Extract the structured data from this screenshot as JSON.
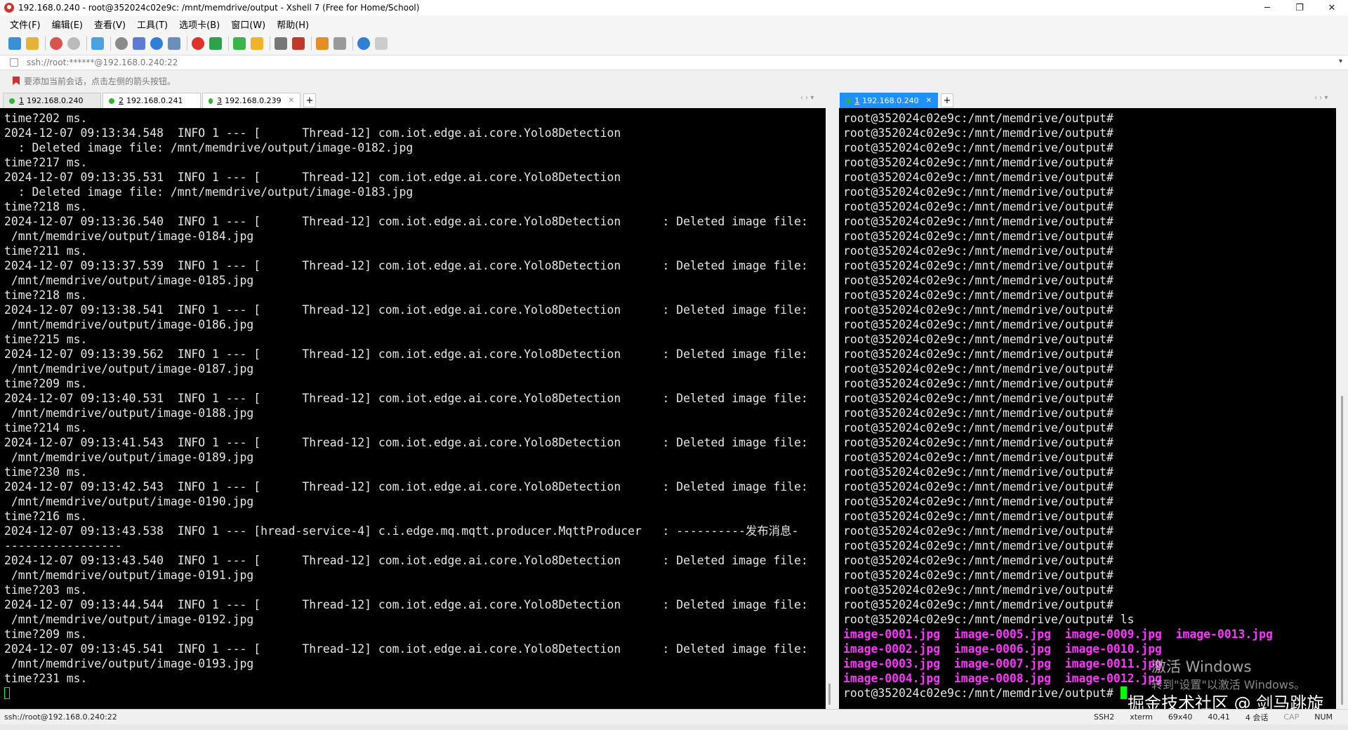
{
  "window": {
    "title": "192.168.0.240 - root@352024c02e9c: /mnt/memdrive/output - Xshell 7 (Free for Home/School)",
    "controls": [
      "─",
      "❐",
      "✕"
    ]
  },
  "menu": [
    "文件(F)",
    "编辑(E)",
    "查看(V)",
    "工具(T)",
    "选项卡(B)",
    "窗口(W)",
    "帮助(H)"
  ],
  "address": {
    "text": "ssh://root:******@192.168.0.240:22"
  },
  "hint": {
    "text": "要添加当前会话，点击左侧的箭头按钮。"
  },
  "left_tabs": [
    {
      "num": "1",
      "label": "192.168.0.240"
    },
    {
      "num": "2",
      "label": "192.168.0.241"
    },
    {
      "num": "3",
      "label": "192.168.0.239"
    }
  ],
  "right_tabs": [
    {
      "num": "1",
      "label": "192.168.0.240"
    }
  ],
  "left_terminal": [
    "time?202 ms.",
    "2024-12-07 09:13:34.548  INFO 1 --- [      Thread-12] com.iot.edge.ai.core.Yolo8Detection",
    "  : Deleted image file: /mnt/memdrive/output/image-0182.jpg",
    "time?217 ms.",
    "2024-12-07 09:13:35.531  INFO 1 --- [      Thread-12] com.iot.edge.ai.core.Yolo8Detection",
    "  : Deleted image file: /mnt/memdrive/output/image-0183.jpg",
    "time?218 ms.",
    "2024-12-07 09:13:36.540  INFO 1 --- [      Thread-12] com.iot.edge.ai.core.Yolo8Detection      : Deleted image file:",
    " /mnt/memdrive/output/image-0184.jpg",
    "time?211 ms.",
    "2024-12-07 09:13:37.539  INFO 1 --- [      Thread-12] com.iot.edge.ai.core.Yolo8Detection      : Deleted image file:",
    " /mnt/memdrive/output/image-0185.jpg",
    "time?218 ms.",
    "2024-12-07 09:13:38.541  INFO 1 --- [      Thread-12] com.iot.edge.ai.core.Yolo8Detection      : Deleted image file:",
    " /mnt/memdrive/output/image-0186.jpg",
    "time?215 ms.",
    "2024-12-07 09:13:39.562  INFO 1 --- [      Thread-12] com.iot.edge.ai.core.Yolo8Detection      : Deleted image file:",
    " /mnt/memdrive/output/image-0187.jpg",
    "time?209 ms.",
    "2024-12-07 09:13:40.531  INFO 1 --- [      Thread-12] com.iot.edge.ai.core.Yolo8Detection      : Deleted image file:",
    " /mnt/memdrive/output/image-0188.jpg",
    "time?214 ms.",
    "2024-12-07 09:13:41.543  INFO 1 --- [      Thread-12] com.iot.edge.ai.core.Yolo8Detection      : Deleted image file:",
    " /mnt/memdrive/output/image-0189.jpg",
    "time?230 ms.",
    "2024-12-07 09:13:42.543  INFO 1 --- [      Thread-12] com.iot.edge.ai.core.Yolo8Detection      : Deleted image file:",
    " /mnt/memdrive/output/image-0190.jpg",
    "time?216 ms.",
    "2024-12-07 09:13:43.538  INFO 1 --- [hread-service-4] c.i.edge.mq.mqtt.producer.MqttProducer   : ----------发布消息-",
    "-----------------",
    "2024-12-07 09:13:43.540  INFO 1 --- [      Thread-12] com.iot.edge.ai.core.Yolo8Detection      : Deleted image file:",
    " /mnt/memdrive/output/image-0191.jpg",
    "time?203 ms.",
    "2024-12-07 09:13:44.544  INFO 1 --- [      Thread-12] com.iot.edge.ai.core.Yolo8Detection      : Deleted image file:",
    " /mnt/memdrive/output/image-0192.jpg",
    "time?209 ms.",
    "2024-12-07 09:13:45.541  INFO 1 --- [      Thread-12] com.iot.edge.ai.core.Yolo8Detection      : Deleted image file:",
    " /mnt/memdrive/output/image-0193.jpg",
    "time?231 ms."
  ],
  "right_terminal": {
    "prompt": "root@352024c02e9c:/mnt/memdrive/output#",
    "empty_prompt_count": 34,
    "command": "ls",
    "ls_rows": [
      "image-0001.jpg  image-0005.jpg  image-0009.jpg  image-0013.jpg",
      "image-0002.jpg  image-0006.jpg  image-0010.jpg",
      "image-0003.jpg  image-0007.jpg  image-0011.jpg",
      "image-0004.jpg  image-0008.jpg  image-0012.jpg"
    ]
  },
  "watermark": {
    "activate_line1": "激活 Windows",
    "activate_line2": "转到\"设置\"以激活 Windows。",
    "brand": "掘金技术社区 @ 剑马跳旋"
  },
  "status": {
    "connection": "ssh://root@192.168.0.240:22",
    "protocol": "SSH2",
    "term": "xterm",
    "size": "69x40",
    "cursor_pos": "40,41",
    "sessions": "4 会话",
    "cap": "CAP",
    "num": "NUM"
  }
}
